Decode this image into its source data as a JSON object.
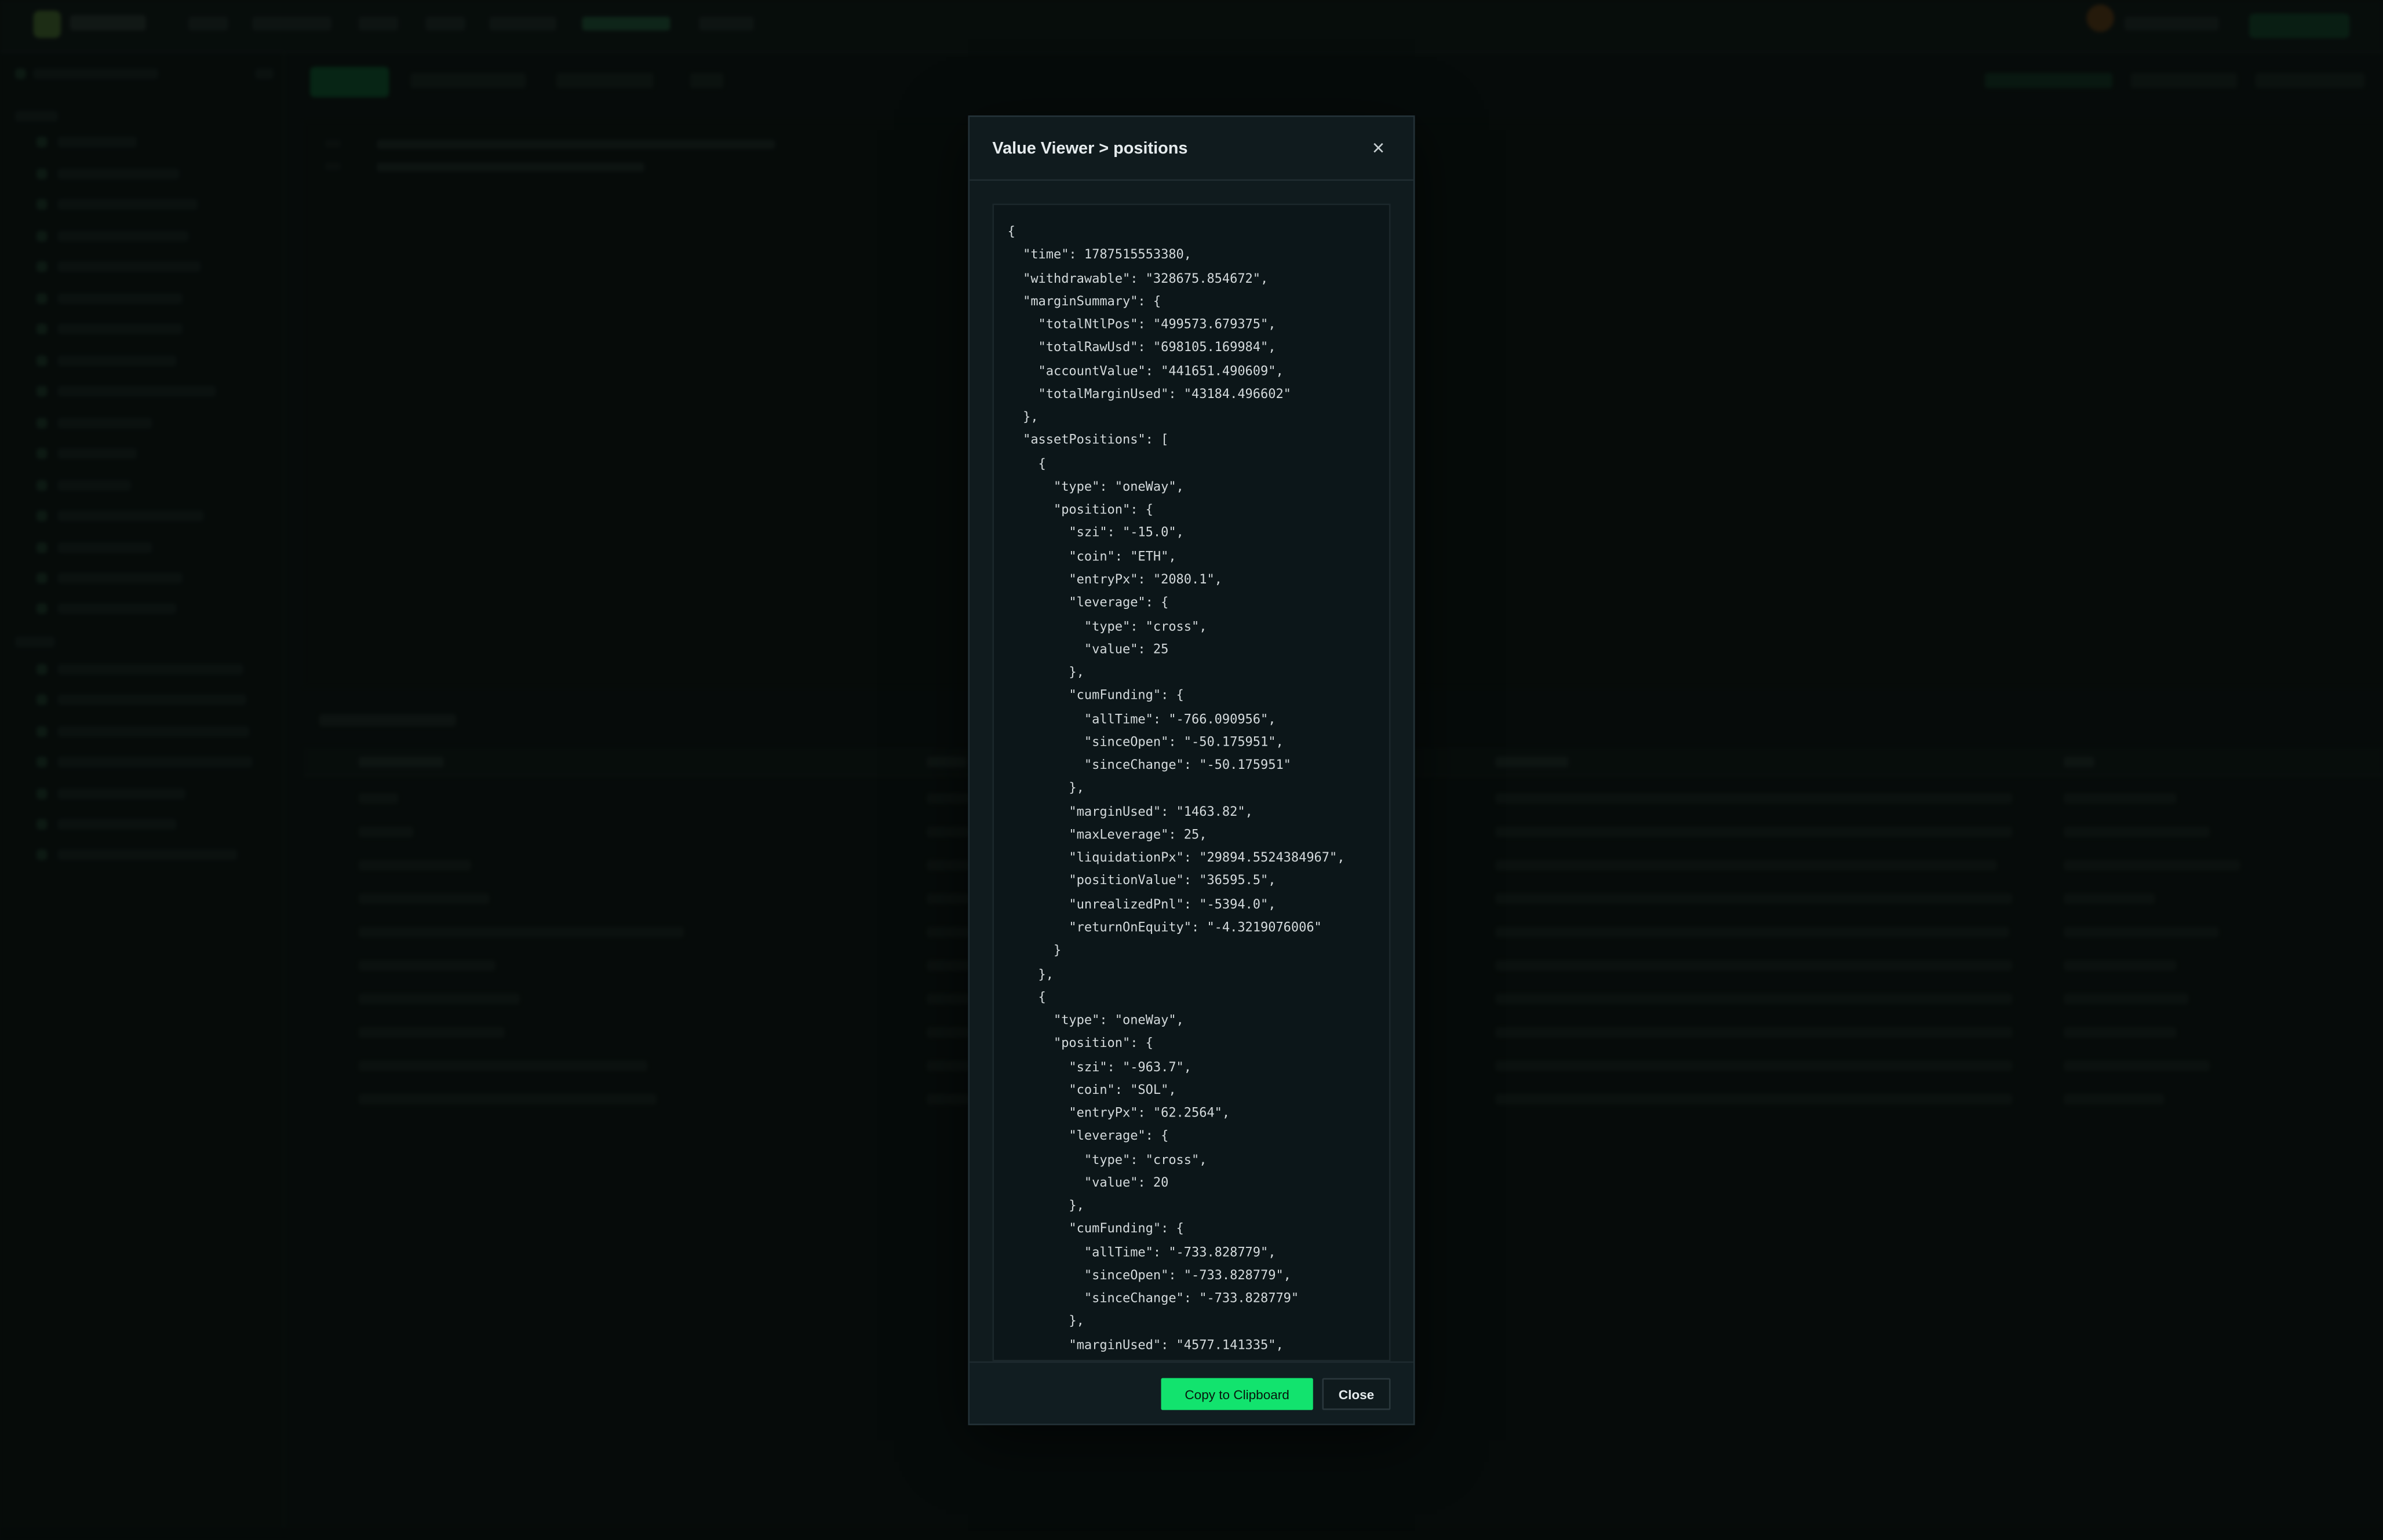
{
  "modal": {
    "title": "Value Viewer > positions",
    "close_icon": "×",
    "json_text": "{\n  \"time\": 1787515553380,\n  \"withdrawable\": \"328675.854672\",\n  \"marginSummary\": {\n    \"totalNtlPos\": \"499573.679375\",\n    \"totalRawUsd\": \"698105.169984\",\n    \"accountValue\": \"441651.490609\",\n    \"totalMarginUsed\": \"43184.496602\"\n  },\n  \"assetPositions\": [\n    {\n      \"type\": \"oneWay\",\n      \"position\": {\n        \"szi\": \"-15.0\",\n        \"coin\": \"ETH\",\n        \"entryPx\": \"2080.1\",\n        \"leverage\": {\n          \"type\": \"cross\",\n          \"value\": 25\n        },\n        \"cumFunding\": {\n          \"allTime\": \"-766.090956\",\n          \"sinceOpen\": \"-50.175951\",\n          \"sinceChange\": \"-50.175951\"\n        },\n        \"marginUsed\": \"1463.82\",\n        \"maxLeverage\": 25,\n        \"liquidationPx\": \"29894.5524384967\",\n        \"positionValue\": \"36595.5\",\n        \"unrealizedPnl\": \"-5394.0\",\n        \"returnOnEquity\": \"-4.3219076006\"\n      }\n    },\n    {\n      \"type\": \"oneWay\",\n      \"position\": {\n        \"szi\": \"-963.7\",\n        \"coin\": \"SOL\",\n        \"entryPx\": \"62.2564\",\n        \"leverage\": {\n          \"type\": \"cross\",\n          \"value\": 20\n        },\n        \"cumFunding\": {\n          \"allTime\": \"-733.828779\",\n          \"sinceOpen\": \"-733.828779\",\n          \"sinceChange\": \"-733.828779\"\n        },\n        \"marginUsed\": \"4577.141335\",",
    "copy_button_label": "Copy to Clipboard",
    "close_button_label": "Close"
  }
}
